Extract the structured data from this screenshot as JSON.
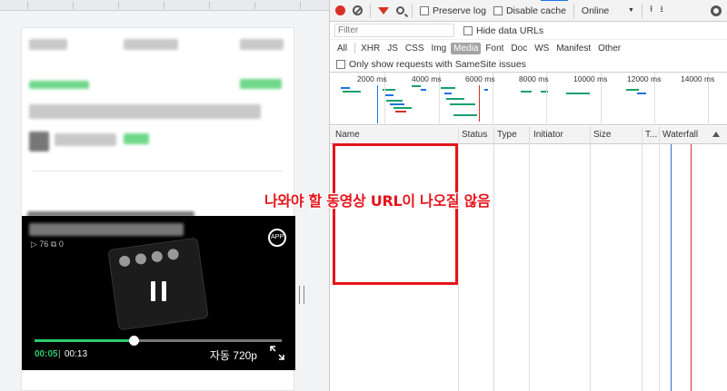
{
  "mobile": {
    "video": {
      "stats": "▷ 76  ⧉ 0",
      "app_badge": "APP",
      "current_time": "00:05",
      "separator": "|",
      "total_time": "00:13",
      "quality": "자동 720p",
      "progress_fraction": 0.4
    }
  },
  "devtools": {
    "toolbar": {
      "preserve_log": "Preserve log",
      "disable_cache": "Disable cache",
      "throttle": "Online",
      "throttle_caret": "▼"
    },
    "filter": {
      "placeholder": "Filter",
      "hide_data_urls": "Hide data URLs"
    },
    "types": [
      "All",
      "XHR",
      "JS",
      "CSS",
      "Img",
      "Media",
      "Font",
      "Doc",
      "WS",
      "Manifest",
      "Other"
    ],
    "active_type": "Media",
    "samesite_label": "Only show requests with SameSite issues",
    "timeline_labels": [
      "2000 ms",
      "4000 ms",
      "6000 ms",
      "8000 ms",
      "10000 ms",
      "12000 ms",
      "14000 ms"
    ],
    "columns": {
      "name": "Name",
      "status": "Status",
      "type": "Type",
      "initiator": "Initiator",
      "size": "Size",
      "time": "T...",
      "waterfall": "Waterfall"
    }
  },
  "annotation": {
    "text": "나와야 할 동영상 URL이 나오질 않음",
    "color": "#e5141b"
  },
  "colors": {
    "record": "#d93025",
    "progress": "#2fc96f",
    "waterfall_blue": "#3367d6",
    "waterfall_red": "#d93025"
  }
}
